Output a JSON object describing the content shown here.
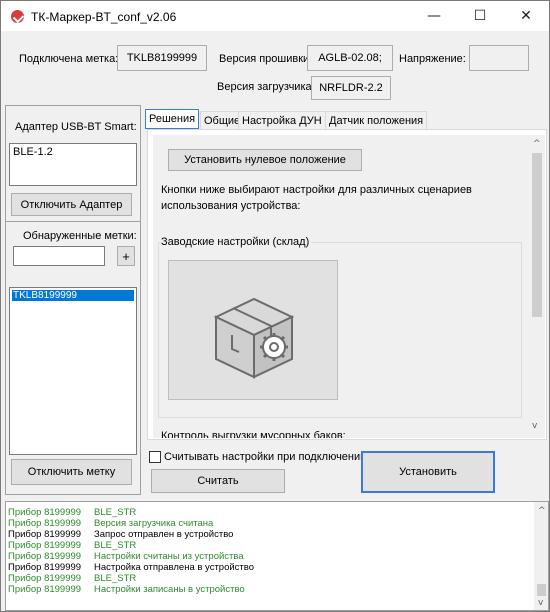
{
  "window": {
    "title": "ТК-Маркер-BT_conf_v2.06",
    "minimize_glyph": "—",
    "maximize_glyph": "☐",
    "close_glyph": "✕"
  },
  "header": {
    "connected_label": "Подключена метка:",
    "connected_value": "TKLB8199999",
    "firmware_label": "Версия прошивки:",
    "firmware_value": "AGLB-02.08;",
    "voltage_label": "Напряжение:",
    "voltage_value": "",
    "bootloader_label": "Версия загрузчика:",
    "bootloader_value": "NRFLDR-2.2"
  },
  "sidebar": {
    "adapter_label": "Адаптер USB-BT Smart:",
    "adapter_list": [
      "BLE-1.2"
    ],
    "disconnect_adapter": "Отключить Адаптер",
    "found_label": "Обнаруженные метки:",
    "filter_value": "",
    "add_glyph": "+",
    "tags_list": [
      "TKLB8199999"
    ],
    "disconnect_tag": "Отключить метку"
  },
  "tabs": [
    {
      "label": "Решения",
      "active": true
    },
    {
      "label": "Общие",
      "active": false
    },
    {
      "label": "Настройка ДУН",
      "active": false
    },
    {
      "label": "Датчик положения",
      "active": false
    }
  ],
  "solutions": {
    "zero_button": "Установить нулевое положение",
    "hint_line1": "Кнопки ниже выбирают настройки для различных сценариев",
    "hint_line2": "использования устройства:",
    "factory_group": "Заводские настройки (склад)",
    "next_group": "Контроль выгрузки мусорных баков:"
  },
  "bottom": {
    "read_on_connect_label": "Считывать настройки при подключении",
    "read_on_connect_checked": false,
    "read_button": "Считать",
    "apply_button": "Установить"
  },
  "colors": {
    "log_green": "#2e8b2e",
    "log_black": "#000000",
    "selection": "#0078d7",
    "focus_border": "#3a7bd5"
  },
  "log": [
    {
      "device": "Прибор 8199999",
      "message": "BLE_STR",
      "color": "green"
    },
    {
      "device": "Прибор 8199999",
      "message": "Версия загрузчика считана",
      "color": "green"
    },
    {
      "device": "Прибор 8199999",
      "message": "Запрос отправлен в устройство",
      "color": "black"
    },
    {
      "device": "Прибор 8199999",
      "message": "BLE_STR",
      "color": "green"
    },
    {
      "device": "Прибор 8199999",
      "message": "Настройки считаны из устройства",
      "color": "green"
    },
    {
      "device": "Прибор 8199999",
      "message": "Настройка отправлена в устройство",
      "color": "black"
    },
    {
      "device": "Прибор 8199999",
      "message": "BLE_STR",
      "color": "green"
    },
    {
      "device": "Прибор 8199999",
      "message": "Настройки записаны в устройство",
      "color": "green"
    }
  ]
}
